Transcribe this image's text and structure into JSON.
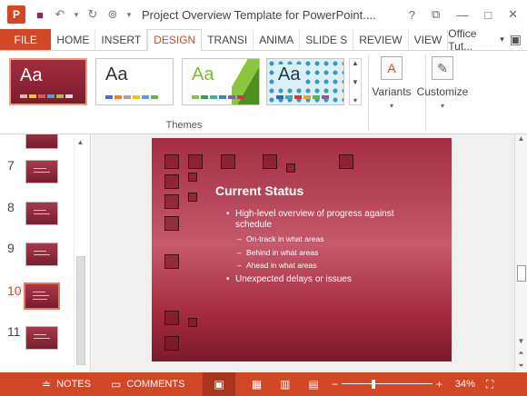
{
  "window": {
    "title": "Project Overview Template for PowerPoint....",
    "help": "?",
    "restore": "⧉",
    "minimize": "—",
    "maximize": "□",
    "close": "✕"
  },
  "quick_access": {
    "app_letter": "P",
    "save_icon": "💾",
    "undo": "↶",
    "undo_dropdown": "▾",
    "redo": "↻",
    "touch_mode": "⊚",
    "customize": "▾"
  },
  "tabs": [
    {
      "label": "FILE"
    },
    {
      "label": "HOME"
    },
    {
      "label": "INSERT"
    },
    {
      "label": "DESIGN"
    },
    {
      "label": "TRANSI"
    },
    {
      "label": "ANIMA"
    },
    {
      "label": "SLIDE S"
    },
    {
      "label": "REVIEW"
    },
    {
      "label": "VIEW"
    }
  ],
  "account": {
    "name": "Office Tut...",
    "caret": "▾"
  },
  "ribbon": {
    "themes_group_label": "Themes",
    "theme_sample": "Aa",
    "variants_label": "Variants",
    "customize_label": "Customize",
    "caret": "▾"
  },
  "slide_pane": {
    "numbers": [
      "7",
      "8",
      "9",
      "10",
      "11"
    ],
    "selected_index": 3
  },
  "slide": {
    "title": "Current Status",
    "bullets": {
      "b1": "High-level overview of progress against schedule",
      "sub": [
        "On-track in what areas",
        "Behind in what areas",
        "Ahead in what areas"
      ],
      "b2": "Unexpected delays or issues"
    }
  },
  "statusbar": {
    "notes": "NOTES",
    "comments": "COMMENTS",
    "zoom": "34%",
    "zoom_level_fraction": 0.34
  },
  "colors": {
    "accent": "#d24726",
    "slide_dark": "#7a1a2c",
    "slide_mid": "#c45a6b"
  }
}
